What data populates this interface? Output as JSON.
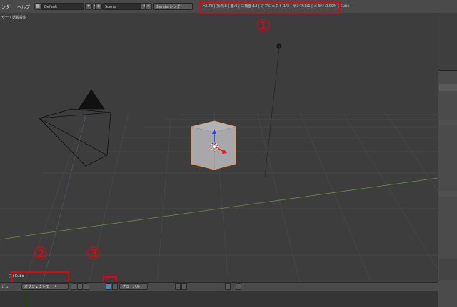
{
  "menu": {
    "render": "ンダ",
    "help": "ヘルプ"
  },
  "screen_layout": "Default",
  "scene": "Scene",
  "render_engine": "Blenderレンダー",
  "stats": "v2.78 | 頂点:8 | 面:6 | 三角面:12 | オブジェクト:1/3 | ランプ:0/1 | メモリ:9.99M | Cube",
  "viewport": {
    "label": "ザー・透視投影",
    "object_name": "(1) Cube"
  },
  "header3d": {
    "view_label": "ビュー",
    "mode": "オブジェクトモード",
    "orientation": "グローバル"
  },
  "annotations": {
    "one": "①",
    "two": "②",
    "three": "③"
  },
  "colors": {
    "annotation": "#e60012",
    "selected_outline": "#f2953c",
    "cube": "#a8a8ab"
  }
}
